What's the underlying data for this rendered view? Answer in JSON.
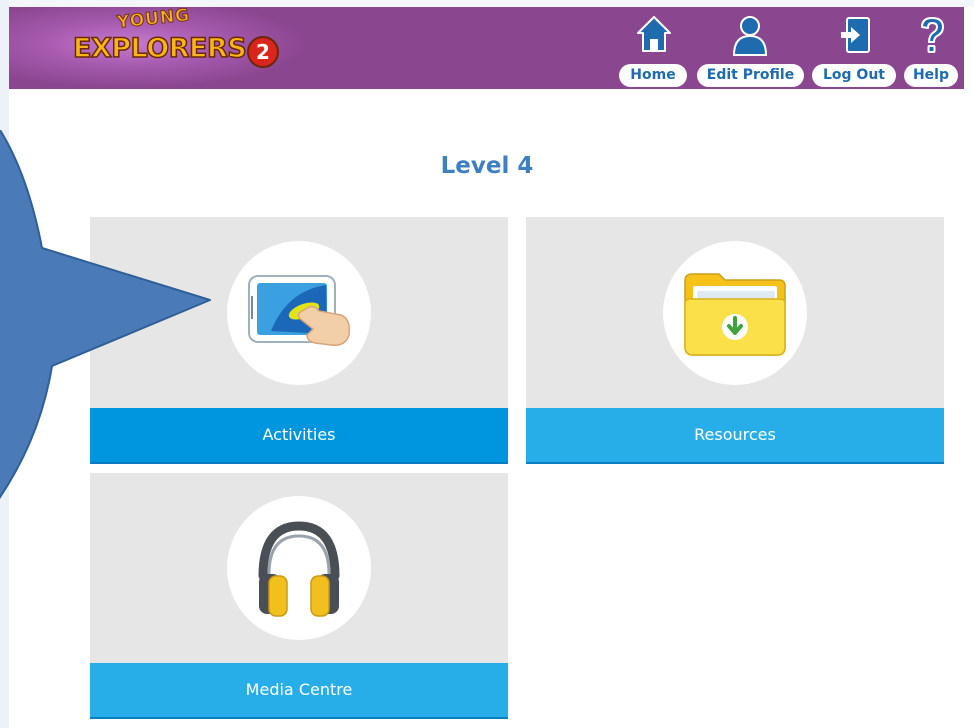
{
  "header": {
    "logo": {
      "top_text": "YOUNG",
      "main_text": "EXPLORERS",
      "number": "2"
    },
    "nav": [
      {
        "label": "Home",
        "icon": "home-icon"
      },
      {
        "label": "Edit Profile",
        "icon": "user-icon"
      },
      {
        "label": "Log Out",
        "icon": "logout-icon"
      },
      {
        "label": "Help",
        "icon": "help-icon"
      }
    ]
  },
  "main": {
    "title": "Level 4",
    "tiles": [
      {
        "label": "Activities",
        "icon": "tablet-touch-icon"
      },
      {
        "label": "Resources",
        "icon": "folder-download-icon"
      },
      {
        "label": "Media Centre",
        "icon": "headphones-icon"
      }
    ]
  },
  "colors": {
    "header_bg": "#8b4690",
    "nav_icon": "#1f6bb0",
    "title": "#3d7fc1",
    "tile_bg": "#e6e6e6",
    "tile_label_bg": "#0096df",
    "callout_fill": "#4b7ab8"
  }
}
